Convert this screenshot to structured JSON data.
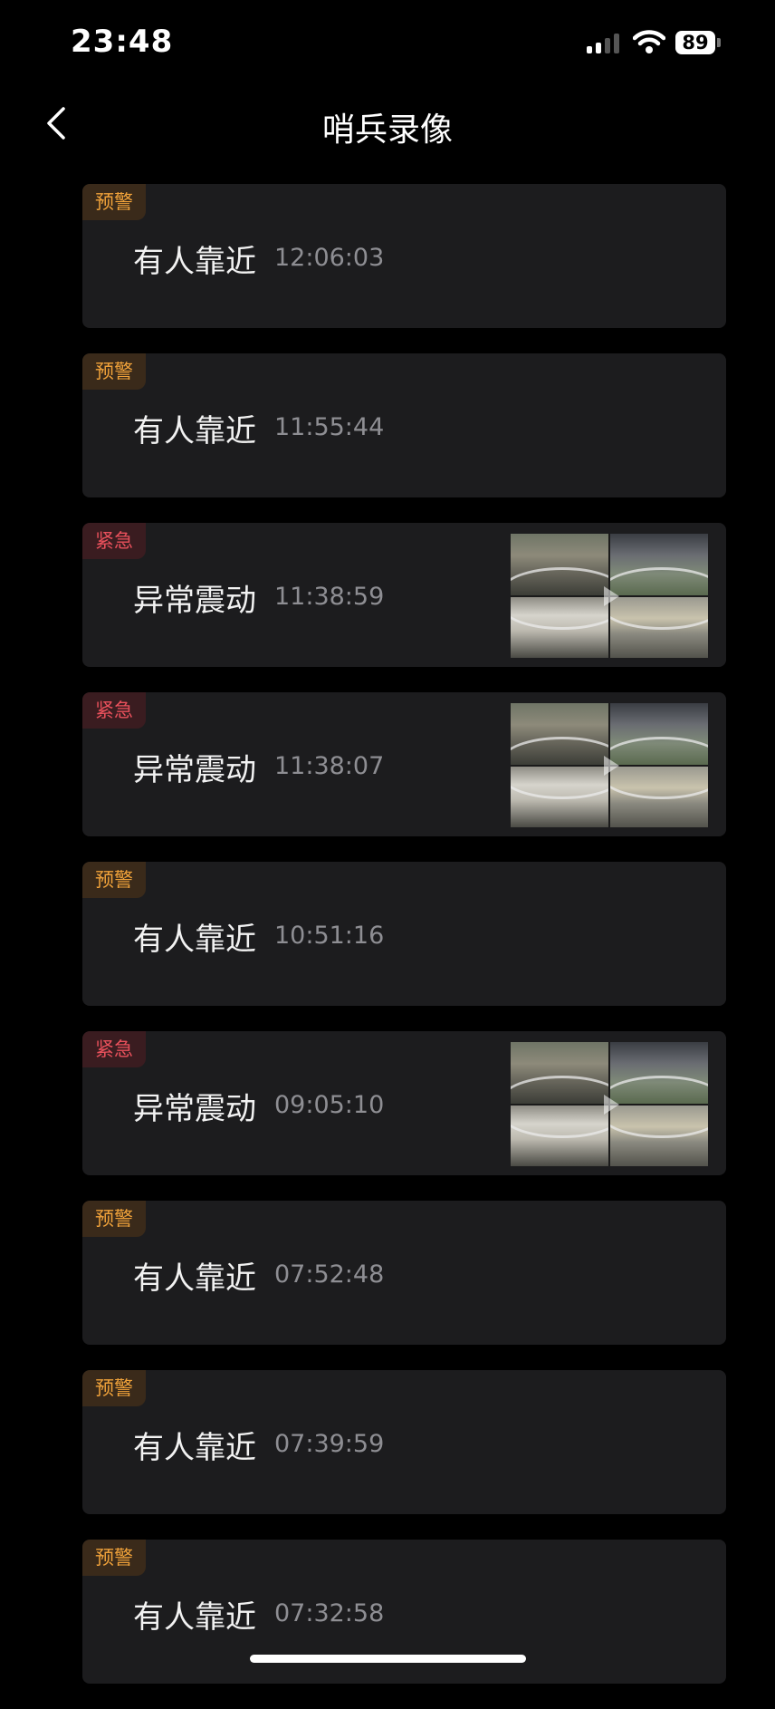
{
  "status": {
    "time": "23:48",
    "battery": "89"
  },
  "nav": {
    "title": "哨兵录像"
  },
  "events": [
    {
      "badge": "预警",
      "level": "warn",
      "label": "有人靠近",
      "time": "12:06:03",
      "thumbnail": false
    },
    {
      "badge": "预警",
      "level": "warn",
      "label": "有人靠近",
      "time": "11:55:44",
      "thumbnail": false
    },
    {
      "badge": "紧急",
      "level": "urgent",
      "label": "异常震动",
      "time": "11:38:59",
      "thumbnail": true
    },
    {
      "badge": "紧急",
      "level": "urgent",
      "label": "异常震动",
      "time": "11:38:07",
      "thumbnail": true
    },
    {
      "badge": "预警",
      "level": "warn",
      "label": "有人靠近",
      "time": "10:51:16",
      "thumbnail": false
    },
    {
      "badge": "紧急",
      "level": "urgent",
      "label": "异常震动",
      "time": "09:05:10",
      "thumbnail": true
    },
    {
      "badge": "预警",
      "level": "warn",
      "label": "有人靠近",
      "time": "07:52:48",
      "thumbnail": false
    },
    {
      "badge": "预警",
      "level": "warn",
      "label": "有人靠近",
      "time": "07:39:59",
      "thumbnail": false
    },
    {
      "badge": "预警",
      "level": "warn",
      "label": "有人靠近",
      "time": "07:32:58",
      "thumbnail": false
    }
  ],
  "colors": {
    "background": "#000000",
    "card": "#1c1c1e",
    "warn": "#f0a23a",
    "urgent": "#e8505b",
    "muted": "#8e8e93"
  },
  "icons": {
    "back": "chevron-left-icon",
    "wifi": "wifi-icon",
    "signal": "cellular-signal-icon",
    "battery": "battery-icon",
    "play": "play-icon"
  }
}
